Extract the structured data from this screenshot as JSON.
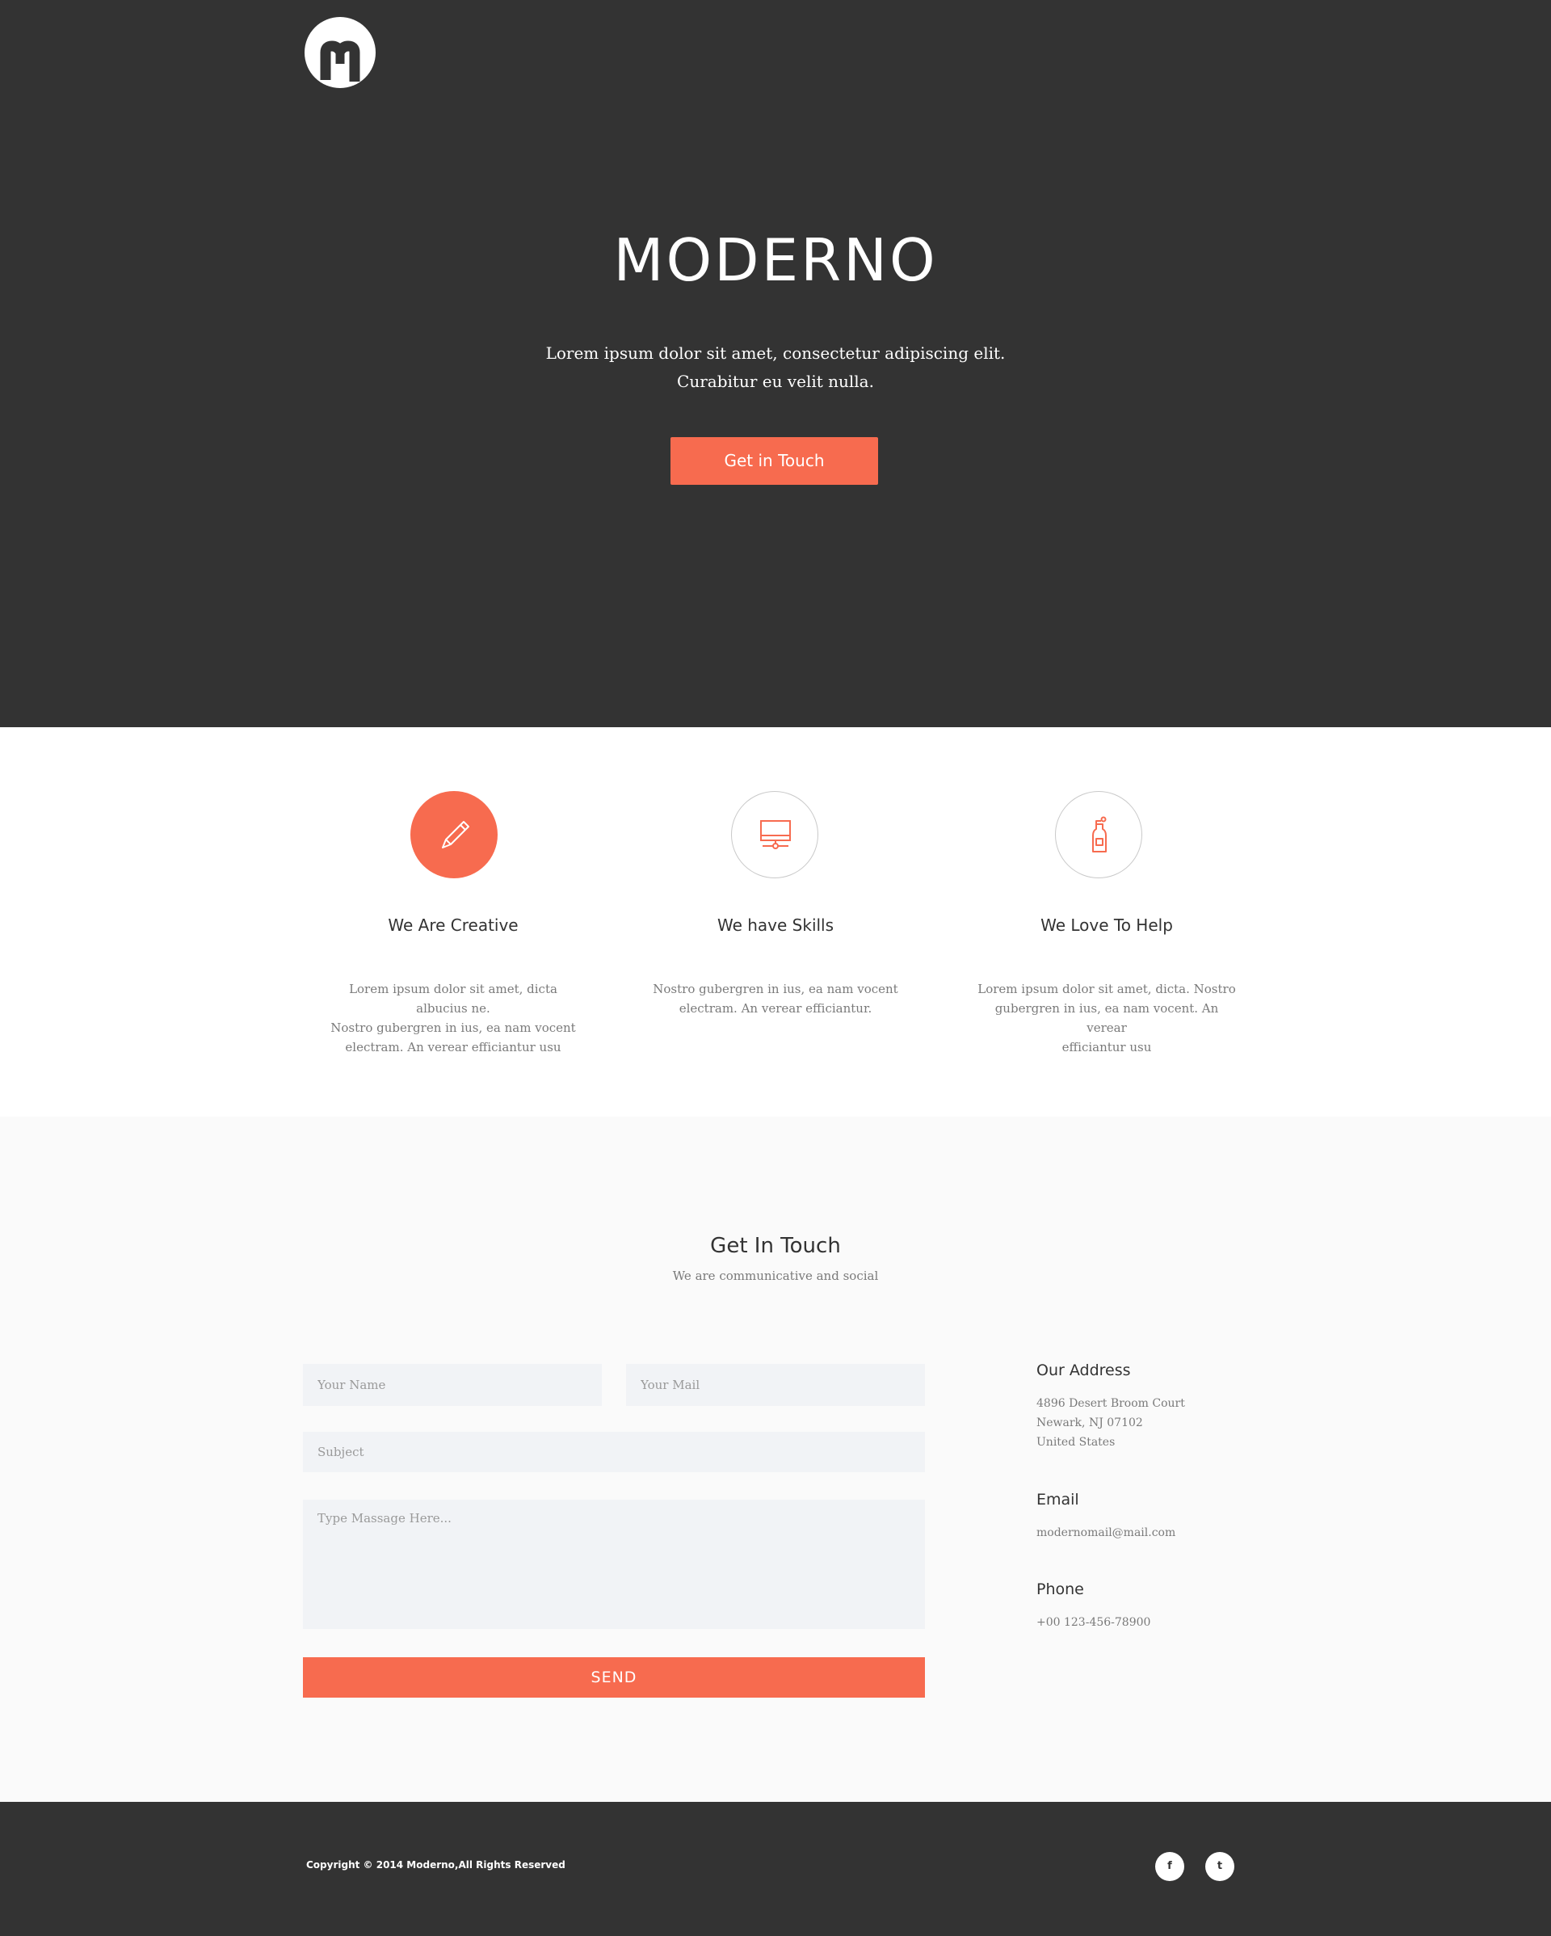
{
  "colors": {
    "accent": "#f76b4f",
    "dark": "#333333",
    "light_bg": "#fafafa",
    "field_bg": "#f1f3f6"
  },
  "header": {
    "logo_icon": "moderno-m-logo"
  },
  "hero": {
    "title": "MODERNO",
    "subtitle_lines": [
      "Lorem ipsum dolor sit amet, consectetur adipiscing elit.",
      "Curabitur eu velit nulla."
    ],
    "cta_label": "Get in Touch"
  },
  "features": [
    {
      "icon": "pencil-icon",
      "title": "We Are Creative",
      "text_lines": [
        "Lorem ipsum dolor sit amet, dicta albucius ne.",
        "Nostro gubergren in ius, ea nam vocent",
        "electram. An verear efficiantur usu"
      ]
    },
    {
      "icon": "monitor-icon",
      "title": "We have Skills",
      "text_lines": [
        "Nostro gubergren in ius, ea nam vocent",
        "electram. An verear efficiantur."
      ]
    },
    {
      "icon": "bottle-icon",
      "title": "We Love To Help",
      "text_lines": [
        "Lorem ipsum dolor sit amet, dicta. Nostro",
        "gubergren in ius, ea nam vocent. An verear",
        "efficiantur usu"
      ]
    }
  ],
  "contact": {
    "title": "Get In Touch",
    "subtitle": "We are communicative and social",
    "form": {
      "name_placeholder": "Your Name",
      "mail_placeholder": "Your Mail",
      "subject_placeholder": "Subject",
      "message_placeholder": "Type Massage Here...",
      "send_label": "SEND"
    },
    "address": {
      "heading": "Our Address",
      "lines": [
        "4896 Desert Broom Court",
        "Newark, NJ 07102",
        "United States"
      ]
    },
    "email": {
      "heading": "Email",
      "value": "modernomail@mail.com"
    },
    "phone": {
      "heading": "Phone",
      "value": "+00 123-456-78900"
    }
  },
  "footer": {
    "copyright": "Copyright © 2014 Moderno,All Rights Reserved",
    "social": [
      {
        "icon": "facebook-icon",
        "glyph": "f"
      },
      {
        "icon": "twitter-icon",
        "glyph": "t"
      }
    ]
  }
}
